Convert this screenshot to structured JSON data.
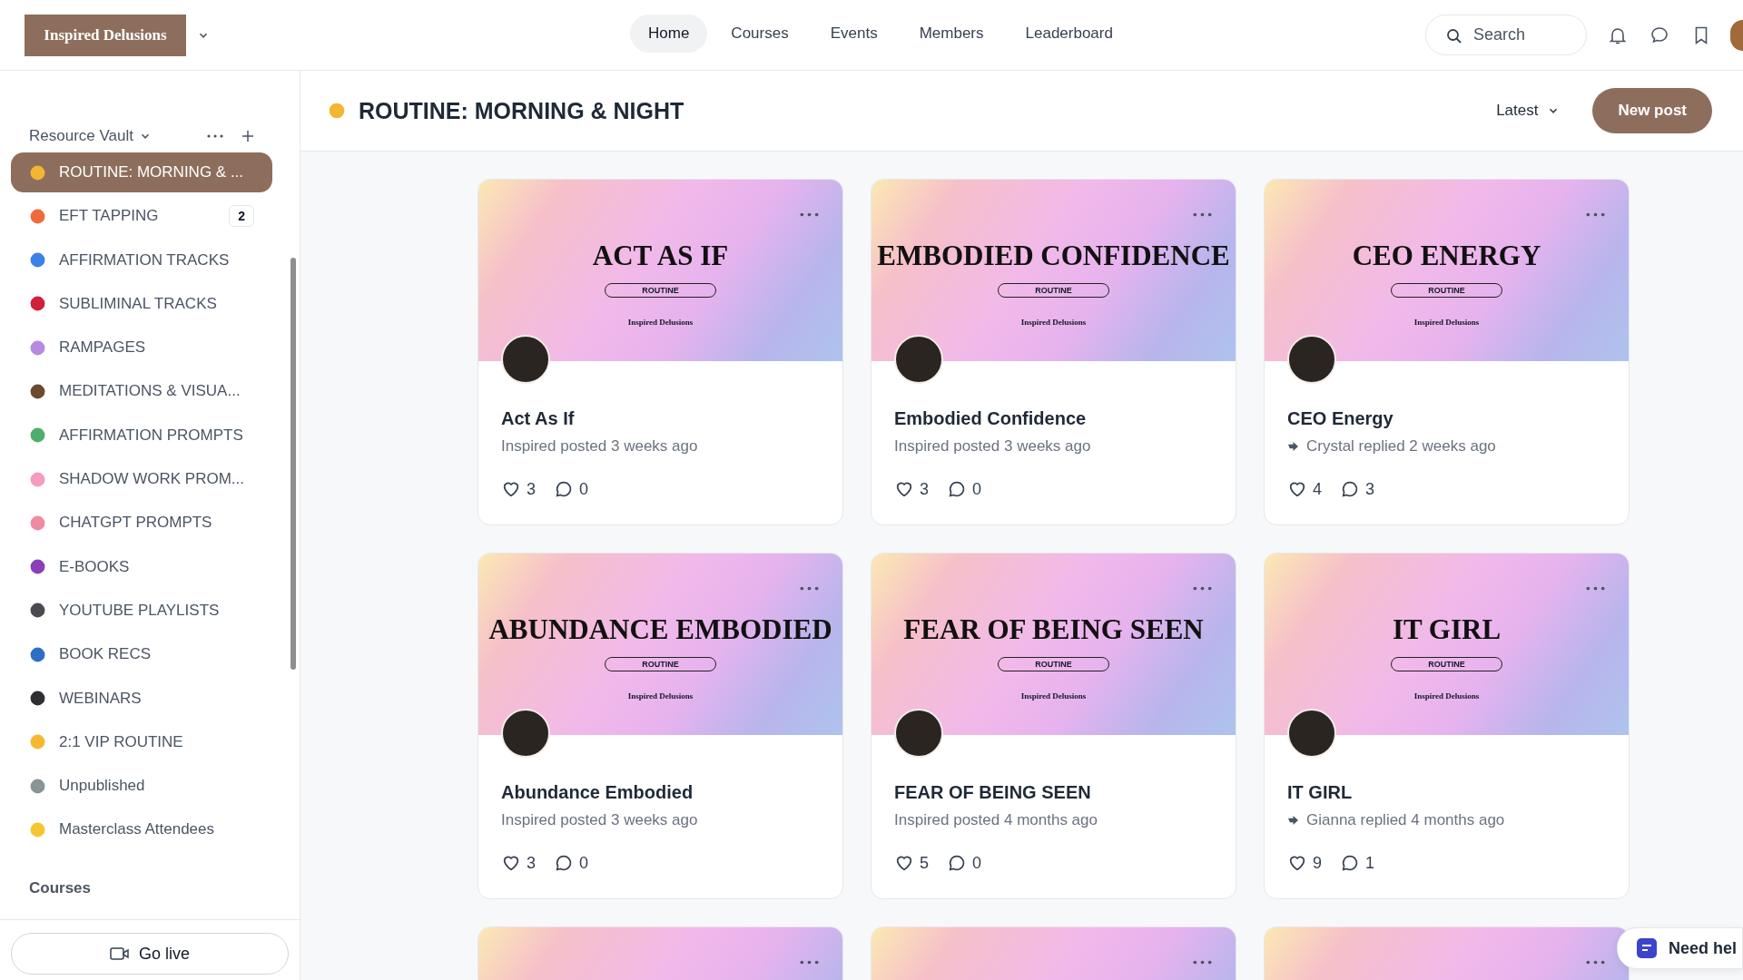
{
  "brand": {
    "name": "Inspired Delusions"
  },
  "nav": [
    {
      "label": "Home",
      "selected": true
    },
    {
      "label": "Courses",
      "selected": false
    },
    {
      "label": "Events",
      "selected": false
    },
    {
      "label": "Members",
      "selected": false
    },
    {
      "label": "Leaderboard",
      "selected": false
    }
  ],
  "search": {
    "placeholder": "Search"
  },
  "sidebar": {
    "section": "Resource Vault",
    "items": [
      {
        "label": "ROUTINE: MORNING & ...",
        "selected": true,
        "color": "#f2b632"
      },
      {
        "label": "EFT TAPPING",
        "selected": false,
        "color": "#f06a3c",
        "badge": "2"
      },
      {
        "label": "AFFIRMATION TRACKS",
        "selected": false,
        "color": "#3b82e6"
      },
      {
        "label": "SUBLIMINAL TRACKS",
        "selected": false,
        "color": "#d0203a"
      },
      {
        "label": "RAMPAGES",
        "selected": false,
        "color": "#b58ae0"
      },
      {
        "label": "MEDITATIONS & VISUA...",
        "selected": false,
        "color": "#6b4a2e"
      },
      {
        "label": "AFFIRMATION PROMPTS",
        "selected": false,
        "color": "#4fae6b"
      },
      {
        "label": "SHADOW WORK PROM...",
        "selected": false,
        "color": "#f59ac0"
      },
      {
        "label": "CHATGPT PROMPTS",
        "selected": false,
        "color": "#f08aa0"
      },
      {
        "label": "E-BOOKS",
        "selected": false,
        "color": "#8a3fb8"
      },
      {
        "label": "YOUTUBE PLAYLISTS",
        "selected": false,
        "color": "#4a4a52"
      },
      {
        "label": "BOOK RECS",
        "selected": false,
        "color": "#2d6fc4"
      },
      {
        "label": "WEBINARS",
        "selected": false,
        "color": "#2e2e33"
      },
      {
        "label": "2:1 VIP ROUTINE",
        "selected": false,
        "color": "#f5b82e"
      },
      {
        "label": "Unpublished",
        "selected": false,
        "color": "#8a9496"
      },
      {
        "label": "Masterclass Attendees",
        "selected": false,
        "color": "#f7c531"
      }
    ],
    "next_section": "Courses",
    "go_live": "Go live"
  },
  "header": {
    "title": "ROUTINE: MORNING & NIGHT",
    "sort": "Latest",
    "new_post": "New post"
  },
  "cards": [
    {
      "banner_title": "ACT AS IF",
      "banner_tag": "ROUTINE",
      "banner_brand": "Inspired Delusions",
      "title": "Act As If",
      "meta": "Inspired posted 3 weeks ago",
      "kind": "posted",
      "likes": "3",
      "comments": "0"
    },
    {
      "banner_title": "EMBODIED CONFIDENCE",
      "banner_tag": "ROUTINE",
      "banner_brand": "Inspired Delusions",
      "title": "Embodied Confidence",
      "meta": "Inspired posted 3 weeks ago",
      "kind": "posted",
      "likes": "3",
      "comments": "0"
    },
    {
      "banner_title": "CEO ENERGY",
      "banner_tag": "ROUTINE",
      "banner_brand": "Inspired Delusions",
      "title": "CEO Energy",
      "meta": "Crystal replied 2 weeks ago",
      "kind": "replied",
      "likes": "4",
      "comments": "3"
    },
    {
      "banner_title": "ABUNDANCE EMBODIED",
      "banner_tag": "ROUTINE",
      "banner_brand": "Inspired Delusions",
      "title": "Abundance Embodied",
      "meta": "Inspired posted 3 weeks ago",
      "kind": "posted",
      "likes": "3",
      "comments": "0"
    },
    {
      "banner_title": "FEAR OF BEING SEEN",
      "banner_tag": "ROUTINE",
      "banner_brand": "Inspired Delusions",
      "title": "FEAR OF BEING SEEN",
      "meta": "Inspired posted 4 months ago",
      "kind": "posted",
      "likes": "5",
      "comments": "0"
    },
    {
      "banner_title": "IT GIRL",
      "banner_tag": "ROUTINE",
      "banner_brand": "Inspired Delusions",
      "title": "IT GIRL",
      "meta": "Gianna replied 4 months ago",
      "kind": "replied",
      "likes": "9",
      "comments": "1"
    }
  ],
  "partial_cards": [
    {
      "kind": "banner"
    },
    {
      "kind": "banner"
    },
    {
      "kind": "banner"
    }
  ],
  "help": {
    "label": "Need hel"
  }
}
